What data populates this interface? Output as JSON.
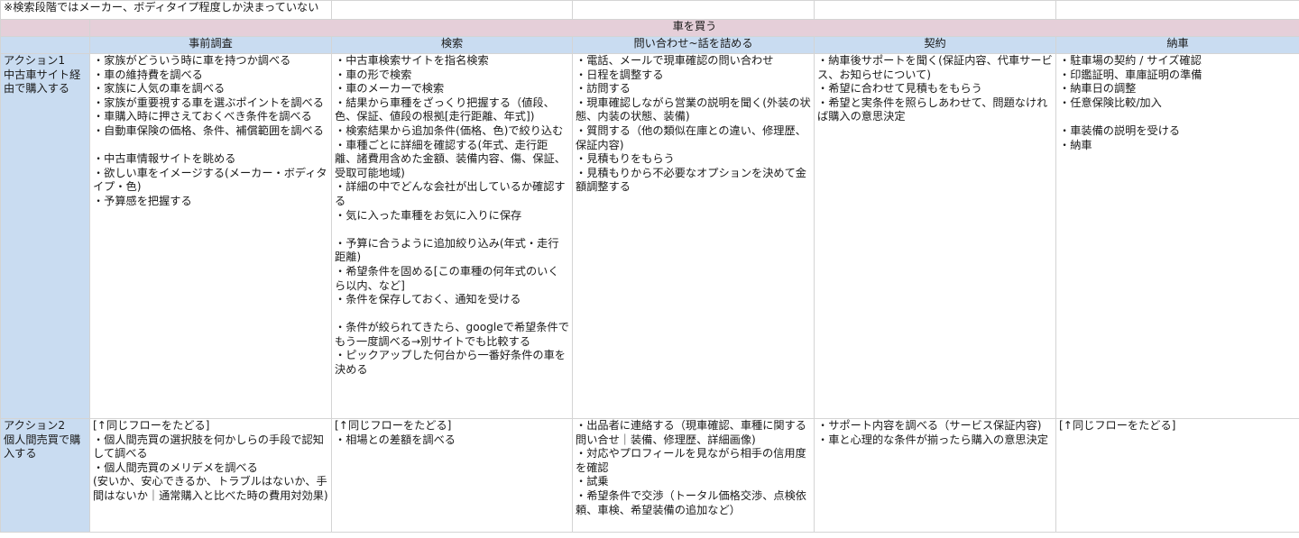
{
  "note": "※検索段階ではメーカー、ボディタイプ程度しか決まっていない",
  "title": "車を買う",
  "phases": [
    "事前調査",
    "検索",
    "問い合わせ~話を詰める",
    "契約",
    "納車"
  ],
  "rows": [
    {
      "action_label": "アクション1\n中古車サイト経由で購入する",
      "cells": [
        "・家族がどういう時に車を持つか調べる\n・車の維持費を調べる\n・家族に人気の車を調べる\n・家族が重要視する車を選ぶポイントを調べる\n・車購入時に押さえておくべき条件を調べる\n・自動車保険の価格、条件、補償範囲を調べる\n\n・中古車情報サイトを眺める\n・欲しい車をイメージする(メーカー・ボディタイプ・色)\n・予算感を把握する",
        "・中古車検索サイトを指名検索\n・車の形で検索\n・車のメーカーで検索\n・結果から車種をざっくり把握する（値段、色、保証、値段の根拠[走行距離、年式])\n・検索結果から追加条件(価格、色)で絞り込む\n・車種ごとに詳細を確認する(年式、走行距離、諸費用含めた金額、装備内容、傷、保証、受取可能地域)\n・詳細の中でどんな会社が出しているか確認する\n・気に入った車種をお気に入りに保存\n\n・予算に合うように追加絞り込み(年式・走行距離)\n・希望条件を固める[この車種の何年式のいくら以内、など]\n・条件を保存しておく、通知を受ける\n\n・条件が絞られてきたら、googleで希望条件でもう一度調べる→別サイトでも比較する\n・ピックアップした何台から一番好条件の車を決める",
        "・電話、メールで現車確認の問い合わせ\n・日程を調整する\n・訪問する\n・現車確認しながら営業の説明を聞く(外装の状態、内装の状態、装備)\n・質問する（他の類似在庫との違い、修理歴、保証内容)\n・見積もりをもらう\n・見積もりから不必要なオプションを決めて金額調整する",
        "・納車後サポートを聞く(保証内容、代車サービス、お知らせについて)\n・希望に合わせて見積もをもらう\n・希望と実条件を照らしあわせて、問題なければ購入の意思決定",
        "・駐車場の契約 / サイズ確認\n・印鑑証明、車庫証明の準備\n・納車日の調整\n・任意保険比較/加入\n\n・車装備の説明を受ける\n・納車"
      ]
    },
    {
      "action_label": "アクション2\n個人間売買で購入する",
      "cells": [
        "[↑同じフローをたどる]\n・個人間売買の選択肢を何かしらの手段で認知して調べる\n・個人間売買のメリデメを調べる\n(安いか、安心できるか、トラブルはないか、手間はないか｜通常購入と比べた時の費用対効果)",
        "[↑同じフローをたどる]\n・相場との差額を調べる",
        "・出品者に連絡する（現車確認、車種に関する問い合せ｜装備、修理歴、詳細画像)\n・対応やプロフィールを見ながら相手の信用度を確認\n・試乗\n・希望条件で交渉（トータル価格交渉、点検依頼、車検、希望装備の追加など）",
        "・サポート内容を調べる（サービス保証内容)\n・車と心理的な条件が揃ったら購入の意思決定",
        "[↑同じフローをたどる]"
      ]
    }
  ]
}
